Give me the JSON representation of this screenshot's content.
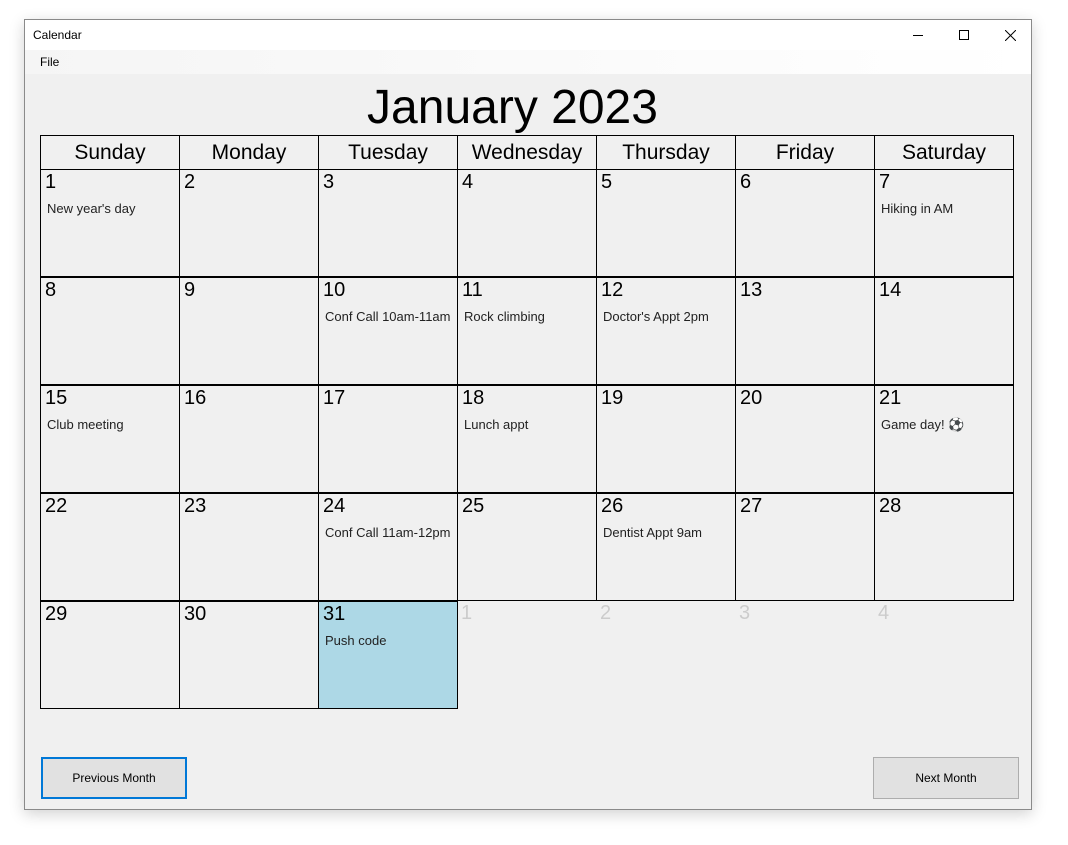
{
  "window": {
    "title": "Calendar",
    "controls": [
      "minimize-icon",
      "maximize-icon",
      "close-icon"
    ]
  },
  "menu": {
    "file": "File"
  },
  "calendar": {
    "month_title": "January 2023",
    "weekdays": [
      "Sunday",
      "Monday",
      "Tuesday",
      "Wednesday",
      "Thursday",
      "Friday",
      "Saturday"
    ],
    "weeks": [
      [
        {
          "day": "1",
          "event": "New year's day"
        },
        {
          "day": "2",
          "event": ""
        },
        {
          "day": "3",
          "event": ""
        },
        {
          "day": "4",
          "event": ""
        },
        {
          "day": "5",
          "event": ""
        },
        {
          "day": "6",
          "event": ""
        },
        {
          "day": "7",
          "event": "Hiking in AM"
        }
      ],
      [
        {
          "day": "8",
          "event": ""
        },
        {
          "day": "9",
          "event": ""
        },
        {
          "day": "10",
          "event": "Conf Call 10am-11am"
        },
        {
          "day": "11",
          "event": "Rock climbing"
        },
        {
          "day": "12",
          "event": "Doctor's Appt 2pm"
        },
        {
          "day": "13",
          "event": ""
        },
        {
          "day": "14",
          "event": ""
        }
      ],
      [
        {
          "day": "15",
          "event": "Club meeting"
        },
        {
          "day": "16",
          "event": ""
        },
        {
          "day": "17",
          "event": ""
        },
        {
          "day": "18",
          "event": "Lunch appt"
        },
        {
          "day": "19",
          "event": ""
        },
        {
          "day": "20",
          "event": ""
        },
        {
          "day": "21",
          "event": "Game  day! ⚽"
        }
      ],
      [
        {
          "day": "22",
          "event": ""
        },
        {
          "day": "23",
          "event": ""
        },
        {
          "day": "24",
          "event": "Conf Call 11am-12pm"
        },
        {
          "day": "25",
          "event": ""
        },
        {
          "day": "26",
          "event": "Dentist Appt 9am"
        },
        {
          "day": "27",
          "event": ""
        },
        {
          "day": "28",
          "event": ""
        }
      ],
      [
        {
          "day": "29",
          "event": ""
        },
        {
          "day": "30",
          "event": ""
        },
        {
          "day": "31",
          "event": "Push code",
          "today": true
        },
        {
          "day": "1",
          "event": "",
          "other_month": true
        },
        {
          "day": "2",
          "event": "",
          "other_month": true
        },
        {
          "day": "3",
          "event": "",
          "other_month": true
        },
        {
          "day": "4",
          "event": "",
          "other_month": true
        }
      ]
    ]
  },
  "buttons": {
    "previous": "Previous Month",
    "next": "Next Month"
  },
  "colors": {
    "today_highlight": "#add8e6",
    "focus_border": "#0078d7",
    "window_bg": "#f0f0f0",
    "other_month_text": "#cccccc"
  }
}
